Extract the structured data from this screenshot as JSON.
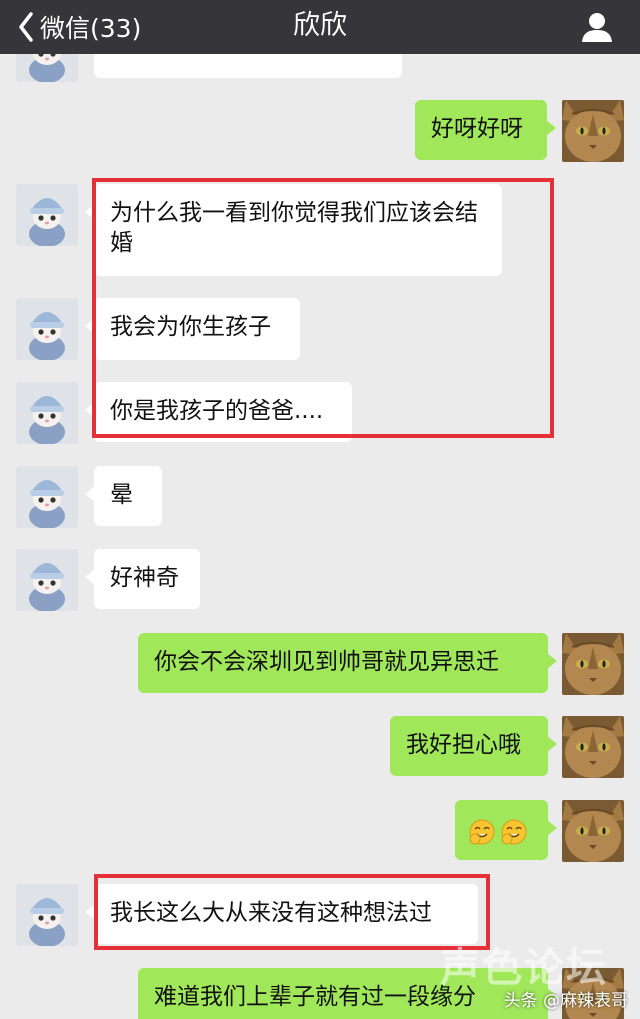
{
  "navbar": {
    "back_label": "微信(33)",
    "title": "欣欣"
  },
  "messages": [
    {
      "side": "in",
      "text": ""
    },
    {
      "side": "out",
      "text": "好呀好呀"
    },
    {
      "side": "in",
      "text": "为什么我一看到你觉得我们应该会结婚"
    },
    {
      "side": "in",
      "text": "我会为你生孩子"
    },
    {
      "side": "in",
      "text": "你是我孩子的爸爸...."
    },
    {
      "side": "in",
      "text": "晕"
    },
    {
      "side": "in",
      "text": "好神奇"
    },
    {
      "side": "out",
      "text": "你会不会深圳见到帅哥就见异思迁"
    },
    {
      "side": "out",
      "text": "我好担心哦"
    },
    {
      "side": "out",
      "text": ""
    },
    {
      "side": "in",
      "text": "我长这么大从来没有这种想法过"
    },
    {
      "side": "out",
      "text": "难道我们上辈子就有过一段缘分"
    }
  ],
  "emoji": {
    "name": "emoji-icon",
    "count": 2
  },
  "watermark": "头条 @麻辣表哥",
  "faint_watermark": "声色论坛",
  "colors": {
    "navbar": "#36363a",
    "background": "#ebebeb",
    "outgoing_bubble": "#a0e75a",
    "incoming_bubble": "#ffffff",
    "highlight_box": "#e5303a"
  }
}
